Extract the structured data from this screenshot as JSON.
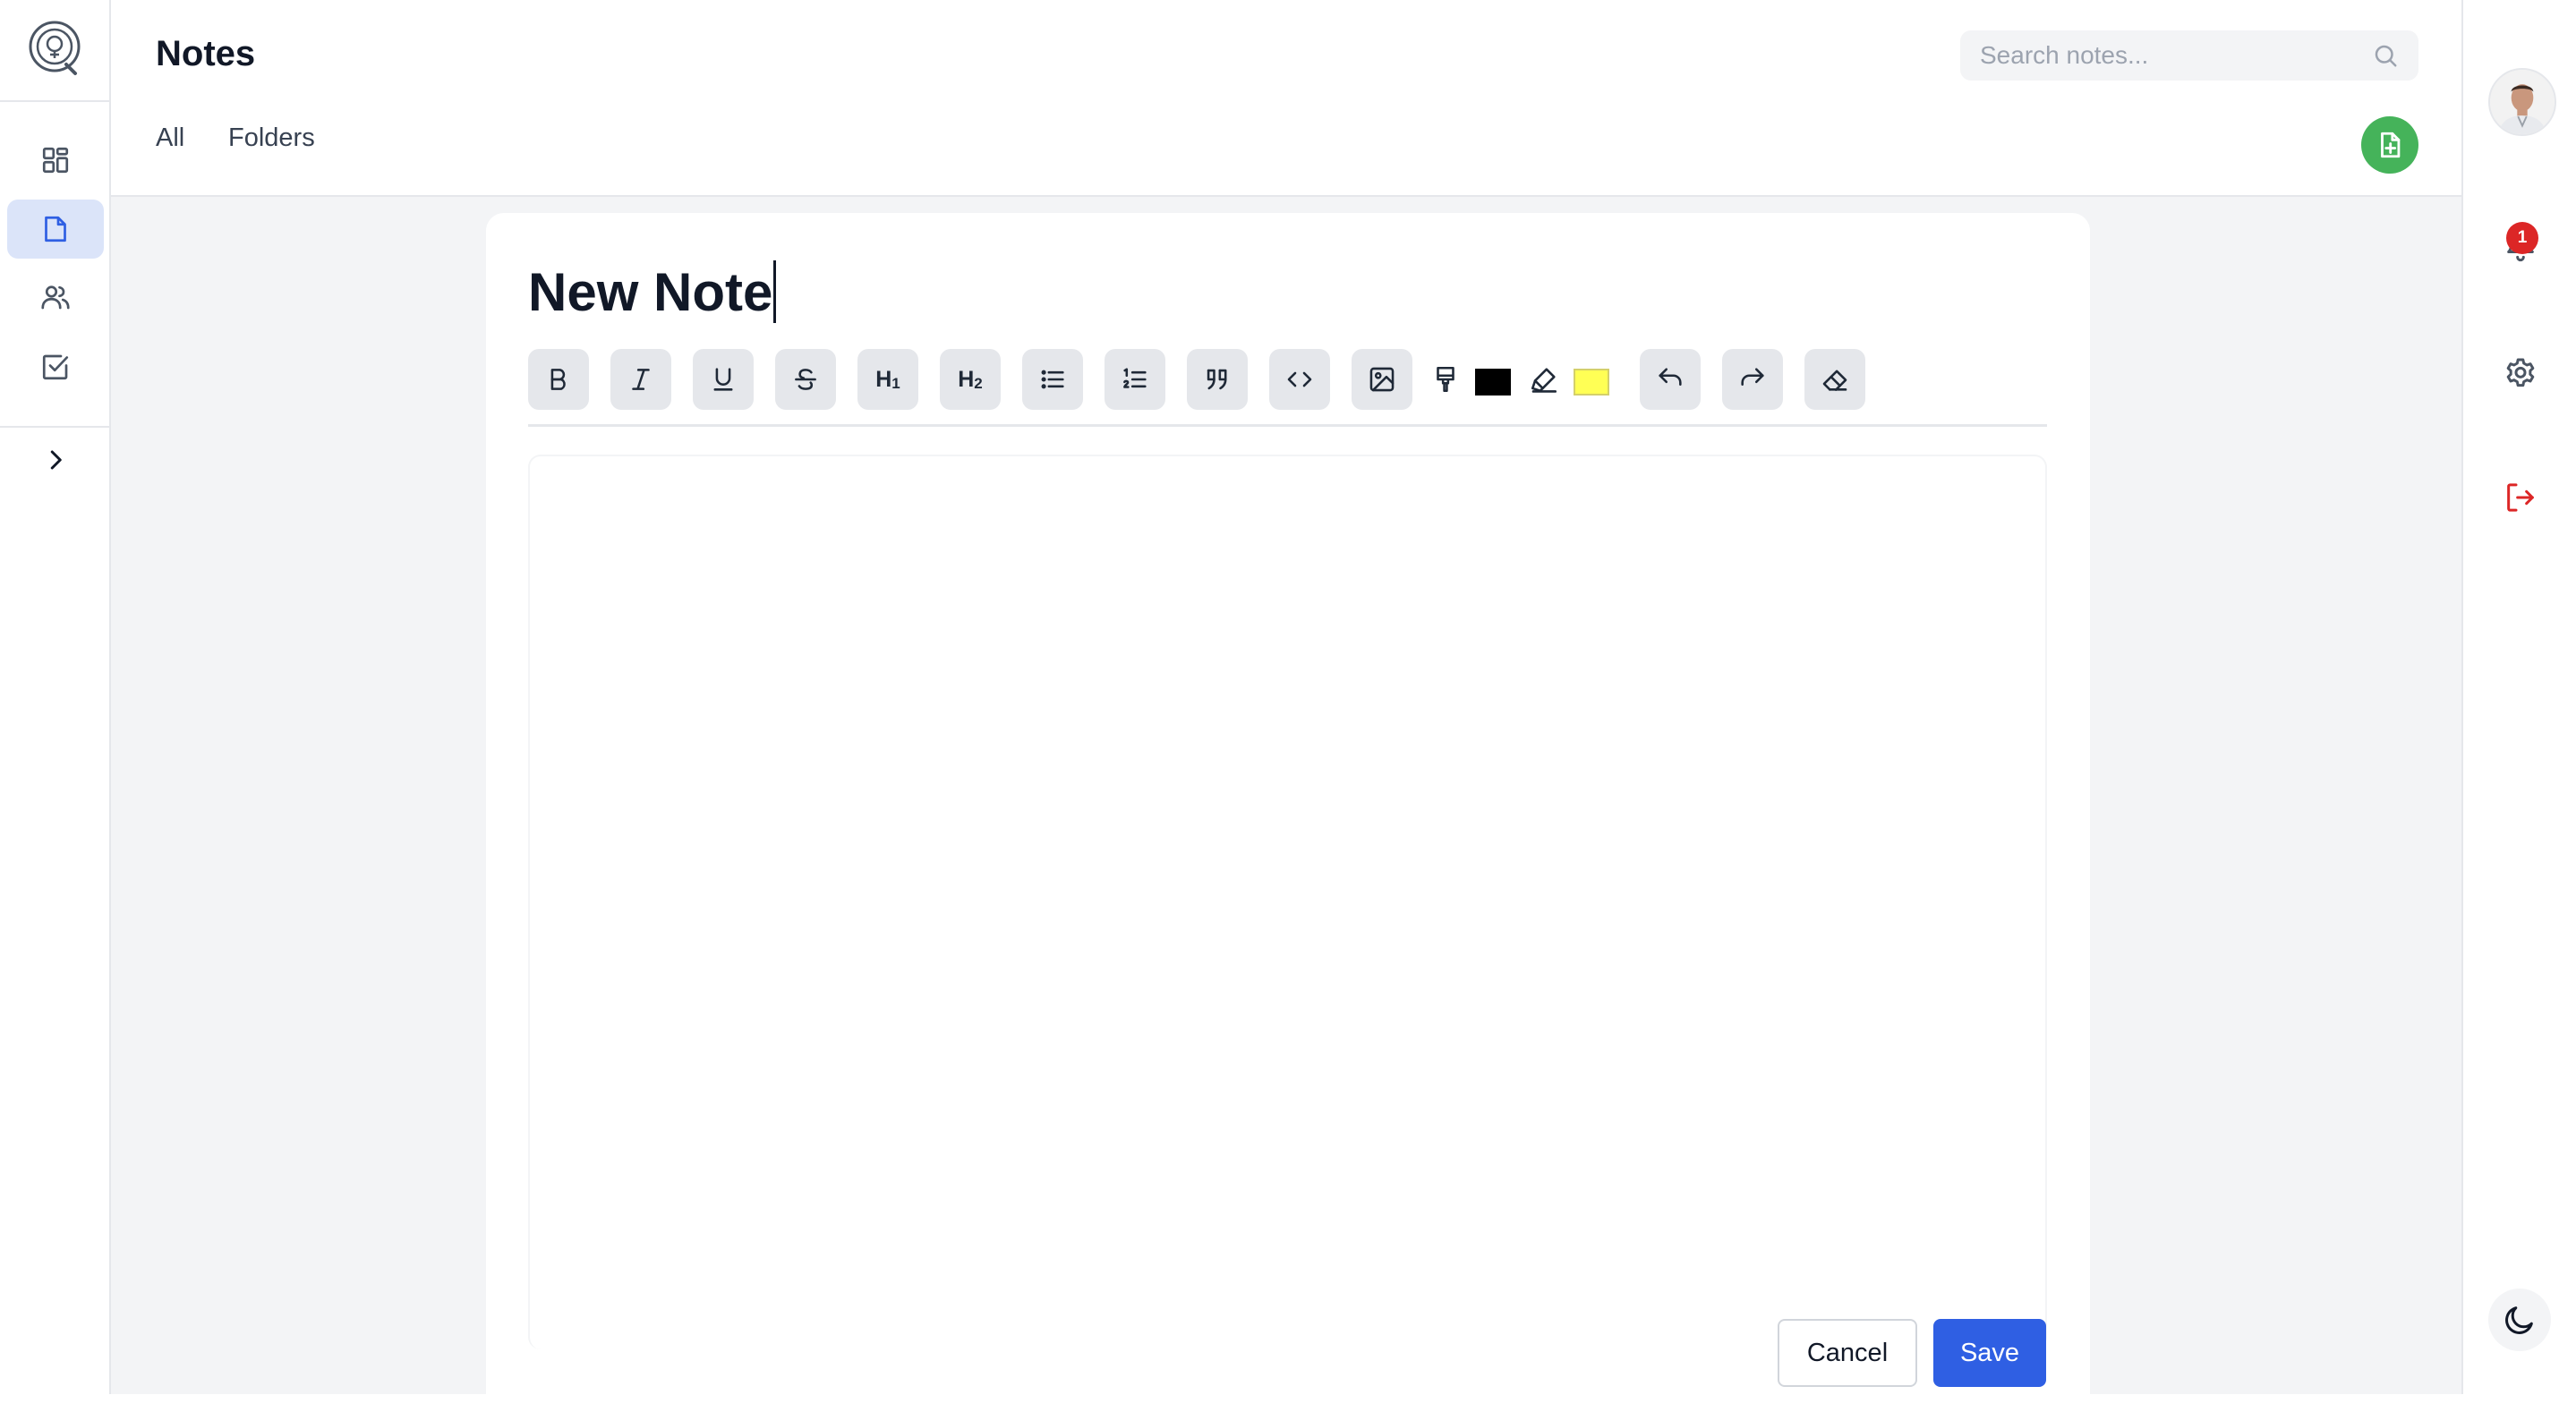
{
  "app": {
    "page_title": "Notes"
  },
  "header": {
    "tabs": [
      {
        "label": "All"
      },
      {
        "label": "Folders"
      }
    ],
    "search": {
      "placeholder": "Search notes...",
      "value": ""
    }
  },
  "left_rail": {
    "items": [
      {
        "icon": "dashboard-icon"
      },
      {
        "icon": "note-icon",
        "active": true
      },
      {
        "icon": "users-icon"
      },
      {
        "icon": "tasks-icon"
      },
      {
        "icon": "chevron-right-icon"
      }
    ]
  },
  "editor": {
    "title": "New Note",
    "toolbar": {
      "heading1_label": "H",
      "heading1_sub": "1",
      "heading2_label": "H",
      "heading2_sub": "2",
      "text_color": "#000000",
      "highlight_color": "#ffff55"
    },
    "buttons": {
      "cancel": "Cancel",
      "save": "Save"
    }
  },
  "right_rail": {
    "notifications_count": "1"
  },
  "colors": {
    "accent_blue": "#2f5fe3",
    "new_note_green": "#45b35a",
    "logout_red": "#dc2626",
    "active_nav_bg": "#dbe4f9"
  }
}
